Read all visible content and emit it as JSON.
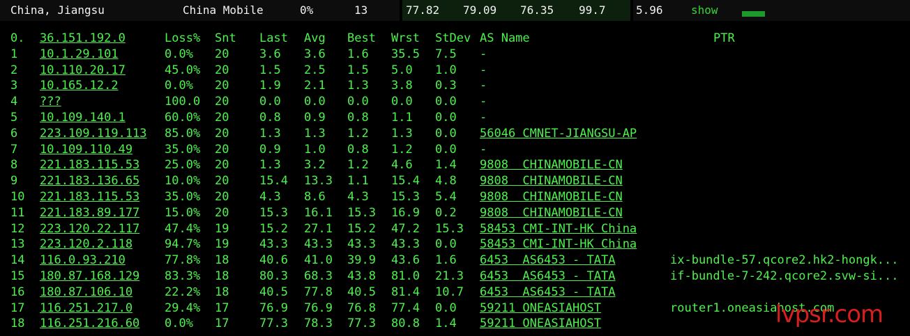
{
  "summary": {
    "location": "China, Jiangsu",
    "isp": "China Mobile",
    "loss": "0%",
    "sent": "13",
    "last": "77.82",
    "avg": "79.09",
    "best": "76.35",
    "worst": "99.7",
    "stdev": "5.96",
    "show_label": "show",
    "accent_bar_color": "#1c9a2c"
  },
  "table": {
    "headers": {
      "index": "0.",
      "host": "36.151.192.0",
      "loss": "Loss%",
      "sent": "Snt",
      "last": "Last",
      "avg": "Avg",
      "best": "Best",
      "worst": "Wrst",
      "stdev": "StDev",
      "as_name": "AS Name",
      "ptr": "PTR"
    },
    "rows": [
      {
        "index": "1",
        "host": "10.1.29.101",
        "loss": "0.0%",
        "sent": "20",
        "last": "3.6",
        "avg": "3.6",
        "best": "1.6",
        "worst": "35.5",
        "stdev": "7.5",
        "as": "-",
        "ptr": ""
      },
      {
        "index": "2",
        "host": "10.110.20.17",
        "loss": "45.0%",
        "sent": "20",
        "last": "1.5",
        "avg": "2.5",
        "best": "1.5",
        "worst": "5.0",
        "stdev": "1.0",
        "as": "-",
        "ptr": ""
      },
      {
        "index": "3",
        "host": "10.165.12.2",
        "loss": "0.0%",
        "sent": "20",
        "last": "1.9",
        "avg": "2.1",
        "best": "1.3",
        "worst": "3.8",
        "stdev": "0.3",
        "as": "-",
        "ptr": ""
      },
      {
        "index": "4",
        "host": "???",
        "loss": "100.0",
        "sent": "20",
        "last": "0.0",
        "avg": "0.0",
        "best": "0.0",
        "worst": "0.0",
        "stdev": "0.0",
        "as": "-",
        "ptr": ""
      },
      {
        "index": "5",
        "host": "10.109.140.1",
        "loss": "60.0%",
        "sent": "20",
        "last": "0.8",
        "avg": "0.9",
        "best": "0.8",
        "worst": "1.1",
        "stdev": "0.0",
        "as": "-",
        "ptr": ""
      },
      {
        "index": "6",
        "host": "223.109.119.113",
        "loss": "85.0%",
        "sent": "20",
        "last": "1.3",
        "avg": "1.3",
        "best": "1.2",
        "worst": "1.3",
        "stdev": "0.0",
        "as": "56046 CMNET-JIANGSU-AP",
        "ptr": ""
      },
      {
        "index": "7",
        "host": "10.109.110.49",
        "loss": "35.0%",
        "sent": "20",
        "last": "0.9",
        "avg": "1.0",
        "best": "0.8",
        "worst": "1.2",
        "stdev": "0.0",
        "as": "-",
        "ptr": ""
      },
      {
        "index": "8",
        "host": "221.183.115.53",
        "loss": "25.0%",
        "sent": "20",
        "last": "1.3",
        "avg": "3.2",
        "best": "1.2",
        "worst": "4.6",
        "stdev": "1.4",
        "as": "9808  CHINAMOBILE-CN",
        "ptr": ""
      },
      {
        "index": "9",
        "host": "221.183.136.65",
        "loss": "10.0%",
        "sent": "20",
        "last": "15.4",
        "avg": "13.3",
        "best": "1.1",
        "worst": "15.4",
        "stdev": "4.8",
        "as": "9808  CHINAMOBILE-CN",
        "ptr": ""
      },
      {
        "index": "10",
        "host": "221.183.115.53",
        "loss": "35.0%",
        "sent": "20",
        "last": "4.3",
        "avg": "8.6",
        "best": "4.3",
        "worst": "15.3",
        "stdev": "5.4",
        "as": "9808  CHINAMOBILE-CN",
        "ptr": ""
      },
      {
        "index": "11",
        "host": "221.183.89.177",
        "loss": "15.0%",
        "sent": "20",
        "last": "15.3",
        "avg": "16.1",
        "best": "15.3",
        "worst": "16.9",
        "stdev": "0.2",
        "as": "9808  CHINAMOBILE-CN",
        "ptr": ""
      },
      {
        "index": "12",
        "host": "223.120.22.117",
        "loss": "47.4%",
        "sent": "19",
        "last": "15.2",
        "avg": "27.1",
        "best": "15.2",
        "worst": "47.2",
        "stdev": "15.3",
        "as": "58453 CMI-INT-HK China",
        "ptr": ""
      },
      {
        "index": "13",
        "host": "223.120.2.118",
        "loss": "94.7%",
        "sent": "19",
        "last": "43.3",
        "avg": "43.3",
        "best": "43.3",
        "worst": "43.3",
        "stdev": "0.0",
        "as": "58453 CMI-INT-HK China",
        "ptr": ""
      },
      {
        "index": "14",
        "host": "116.0.93.210",
        "loss": "77.8%",
        "sent": "18",
        "last": "40.6",
        "avg": "41.0",
        "best": "39.9",
        "worst": "43.6",
        "stdev": "1.6",
        "as": "6453  AS6453 - TATA",
        "ptr": "ix-bundle-57.qcore2.hk2-hongk..."
      },
      {
        "index": "15",
        "host": "180.87.168.129",
        "loss": "83.3%",
        "sent": "18",
        "last": "80.3",
        "avg": "68.3",
        "best": "43.8",
        "worst": "81.0",
        "stdev": "21.3",
        "as": "6453  AS6453 - TATA",
        "ptr": "if-bundle-7-242.qcore2.svw-si..."
      },
      {
        "index": "16",
        "host": "180.87.106.10",
        "loss": "22.2%",
        "sent": "18",
        "last": "40.5",
        "avg": "77.8",
        "best": "40.5",
        "worst": "81.4",
        "stdev": "10.7",
        "as": "6453  AS6453 - TATA",
        "ptr": ""
      },
      {
        "index": "17",
        "host": "116.251.217.0",
        "loss": "29.4%",
        "sent": "17",
        "last": "76.9",
        "avg": "76.9",
        "best": "76.8",
        "worst": "77.4",
        "stdev": "0.0",
        "as": "59211 ONEASIAHOST",
        "ptr": "router1.oneasiahost.com"
      },
      {
        "index": "18",
        "host": "116.251.216.60",
        "loss": "0.0%",
        "sent": "17",
        "last": "77.3",
        "avg": "78.3",
        "best": "77.3",
        "worst": "80.8",
        "stdev": "1.4",
        "as": "59211 ONEASIAHOST",
        "ptr": ""
      }
    ]
  },
  "watermark": "lvpsr.com",
  "colors": {
    "background": "#000000",
    "text_green": "#4ef04e",
    "summary_green_bg": "#0d200d",
    "watermark_red": "#d81e1e"
  }
}
